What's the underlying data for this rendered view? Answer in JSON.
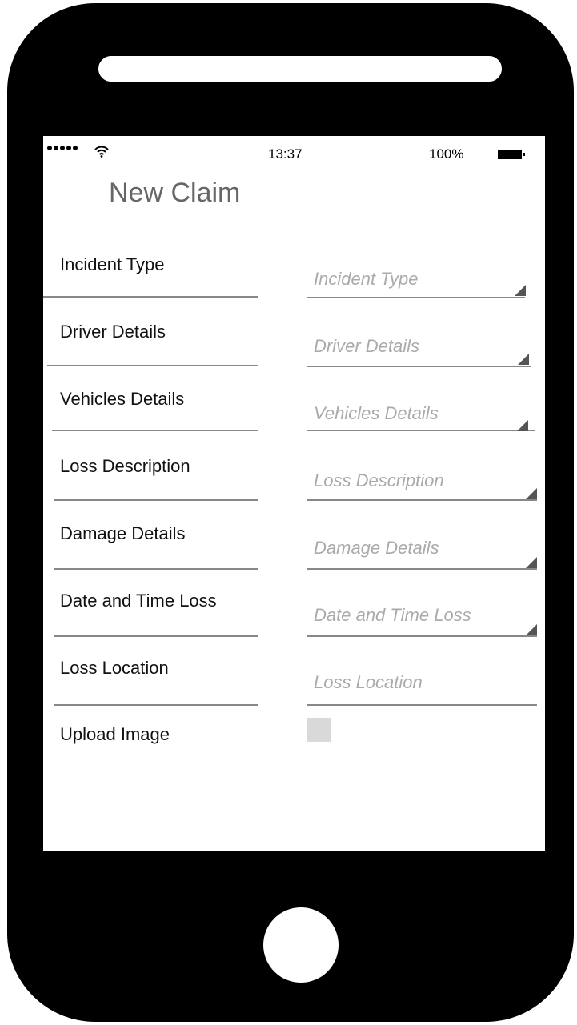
{
  "status_bar": {
    "time": "13:37",
    "battery": "100%"
  },
  "page": {
    "title": "New Claim"
  },
  "fields": [
    {
      "label": "Incident Type",
      "placeholder": "Incident Type"
    },
    {
      "label": "Driver Details",
      "placeholder": "Driver Details"
    },
    {
      "label": "Vehicles  Details",
      "placeholder": "Vehicles  Details"
    },
    {
      "label": "Loss Description",
      "placeholder": "Loss Description"
    },
    {
      "label": "Damage Details",
      "placeholder": "Damage Details"
    },
    {
      "label": "Date and Time Loss",
      "placeholder": "Date and Time Loss"
    },
    {
      "label": "Loss Location",
      "placeholder": "Loss Location"
    }
  ],
  "upload": {
    "label": "Upload Image"
  }
}
